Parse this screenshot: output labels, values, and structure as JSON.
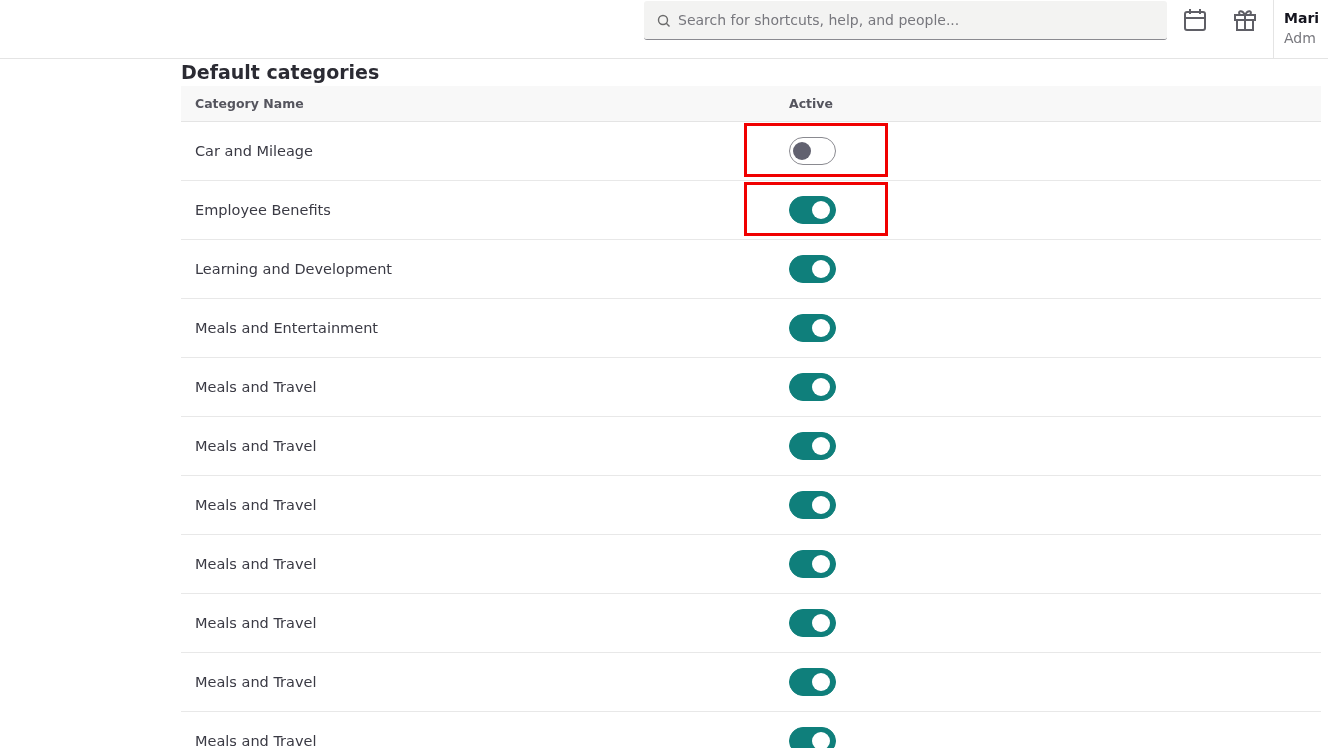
{
  "top_bar": {
    "search": {
      "placeholder": "Search for shortcuts, help, and people..."
    },
    "user": {
      "name": "Mari",
      "role": "Adm"
    }
  },
  "section": {
    "title": "Default categories"
  },
  "table": {
    "columns": [
      "Category Name",
      "Active"
    ],
    "rows": [
      {
        "name": "Car and Mileage",
        "active": false,
        "highlighted": true
      },
      {
        "name": "Employee Benefits",
        "active": true,
        "highlighted": true
      },
      {
        "name": "Learning and Development",
        "active": true,
        "highlighted": false
      },
      {
        "name": "Meals and Entertainment",
        "active": true,
        "highlighted": false
      },
      {
        "name": "Meals and Travel",
        "active": true,
        "highlighted": false
      },
      {
        "name": "Meals and Travel",
        "active": true,
        "highlighted": false
      },
      {
        "name": "Meals and Travel",
        "active": true,
        "highlighted": false
      },
      {
        "name": "Meals and Travel",
        "active": true,
        "highlighted": false
      },
      {
        "name": "Meals and Travel",
        "active": true,
        "highlighted": false
      },
      {
        "name": "Meals and Travel",
        "active": true,
        "highlighted": false
      },
      {
        "name": "Meals and Travel",
        "active": true,
        "highlighted": false
      }
    ]
  }
}
